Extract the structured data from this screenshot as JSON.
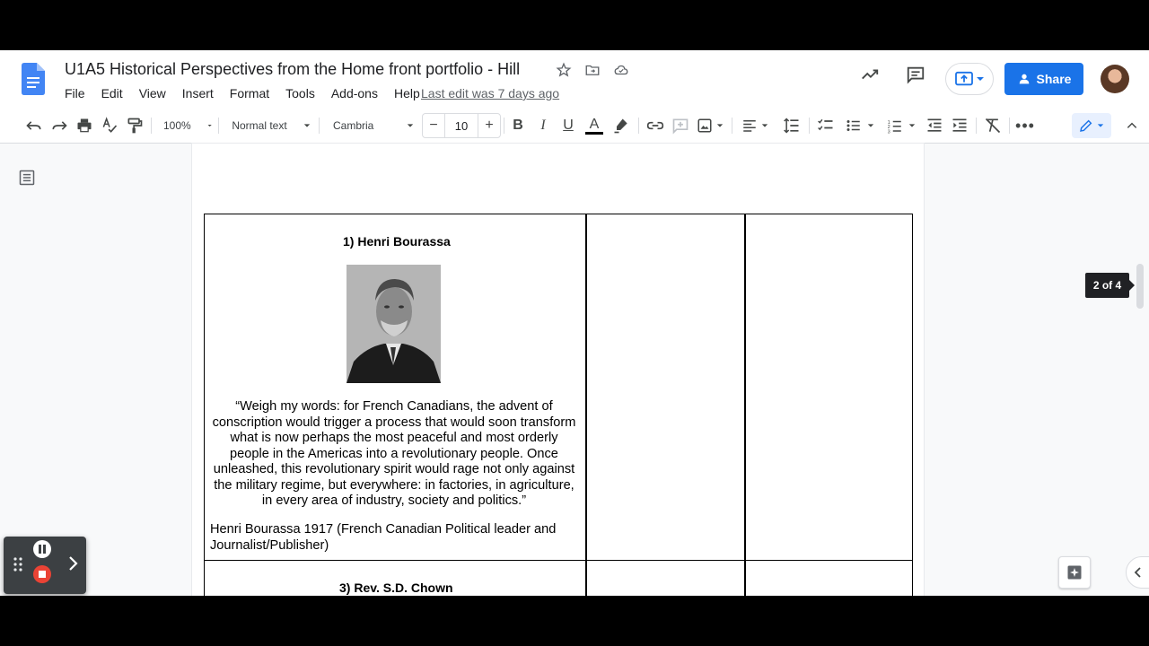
{
  "document": {
    "title": "U1A5  Historical Perspectives from the Home front portfolio - Hill",
    "last_edit": "Last edit was 7 days ago"
  },
  "menu": {
    "items": [
      "File",
      "Edit",
      "View",
      "Insert",
      "Format",
      "Tools",
      "Add-ons",
      "Help"
    ]
  },
  "header": {
    "share_label": "Share"
  },
  "toolbar": {
    "zoom": "100%",
    "style": "Normal text",
    "font": "Cambria",
    "font_size": "10"
  },
  "content": {
    "entry1_title": "1)  Henri Bourassa",
    "quote": "“Weigh my words: for French Canadians, the advent of conscription would trigger a process that would soon transform what is now perhaps the most peaceful and most orderly people in the Americas into a revolutionary people. Once unleashed, this revolutionary spirit would rage not only against the military regime, but everywhere: in factories, in agriculture, in every area of industry, society and politics.”",
    "attribution": "Henri Bourassa 1917 (French Canadian Political leader and Journalist/Publisher)",
    "entry3_title": "3)  Rev. S.D. Chown"
  },
  "page_indicator": "2 of 4",
  "colors": {
    "share_bg": "#1a73e8",
    "docs_blue": "#4285f4",
    "recorder_stop": "#ea4335"
  }
}
